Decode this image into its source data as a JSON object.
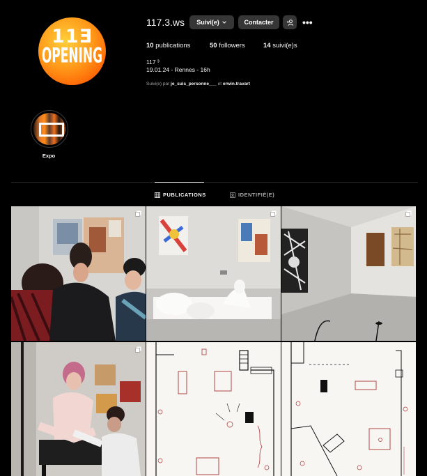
{
  "profile": {
    "avatar_line1": "11Ǝ",
    "avatar_line2": "OPENING",
    "username": "117.3.ws",
    "follow_label": "Suivi(e)",
    "contact_label": "Contacter",
    "more_label": "•••",
    "stats": {
      "publications_count": "10",
      "publications_label": "publications",
      "followers_count": "50",
      "followers_label": "followers",
      "following_count": "14",
      "following_label": "suivi(e)s"
    },
    "bio_name": "117 ³",
    "bio_line": "19.01.24 - Rennes - 16h",
    "followed_by_prefix": "Suivi(e) par",
    "followed_by_user1": "je_suis_personne___",
    "followed_by_sep": "et",
    "followed_by_user2": "erwin.travart"
  },
  "highlights": [
    {
      "label": "Expo",
      "icon": "exhibition-thumbnail"
    }
  ],
  "tabs": [
    {
      "label": "PUBLICATIONS",
      "icon": "grid-icon",
      "active": true
    },
    {
      "label": "IDENTIFIÉ(E)",
      "icon": "tagged-icon",
      "active": false
    }
  ],
  "posts": [
    {
      "id": 1,
      "subject": "people-at-gallery",
      "multi": true
    },
    {
      "id": 2,
      "subject": "white-sculpture",
      "multi": true
    },
    {
      "id": 3,
      "subject": "empty-gallery-room",
      "multi": true
    },
    {
      "id": 4,
      "subject": "tattoo-session",
      "multi": true
    },
    {
      "id": 5,
      "subject": "floor-plan-sketch",
      "multi": false
    },
    {
      "id": 6,
      "subject": "floor-plan-sketch-2",
      "multi": false
    }
  ],
  "colors": {
    "background": "#000000",
    "button": "#363636",
    "text": "#f5f5f5",
    "muted": "#a8a8a8",
    "avatar_orange": "#ff7a00"
  }
}
